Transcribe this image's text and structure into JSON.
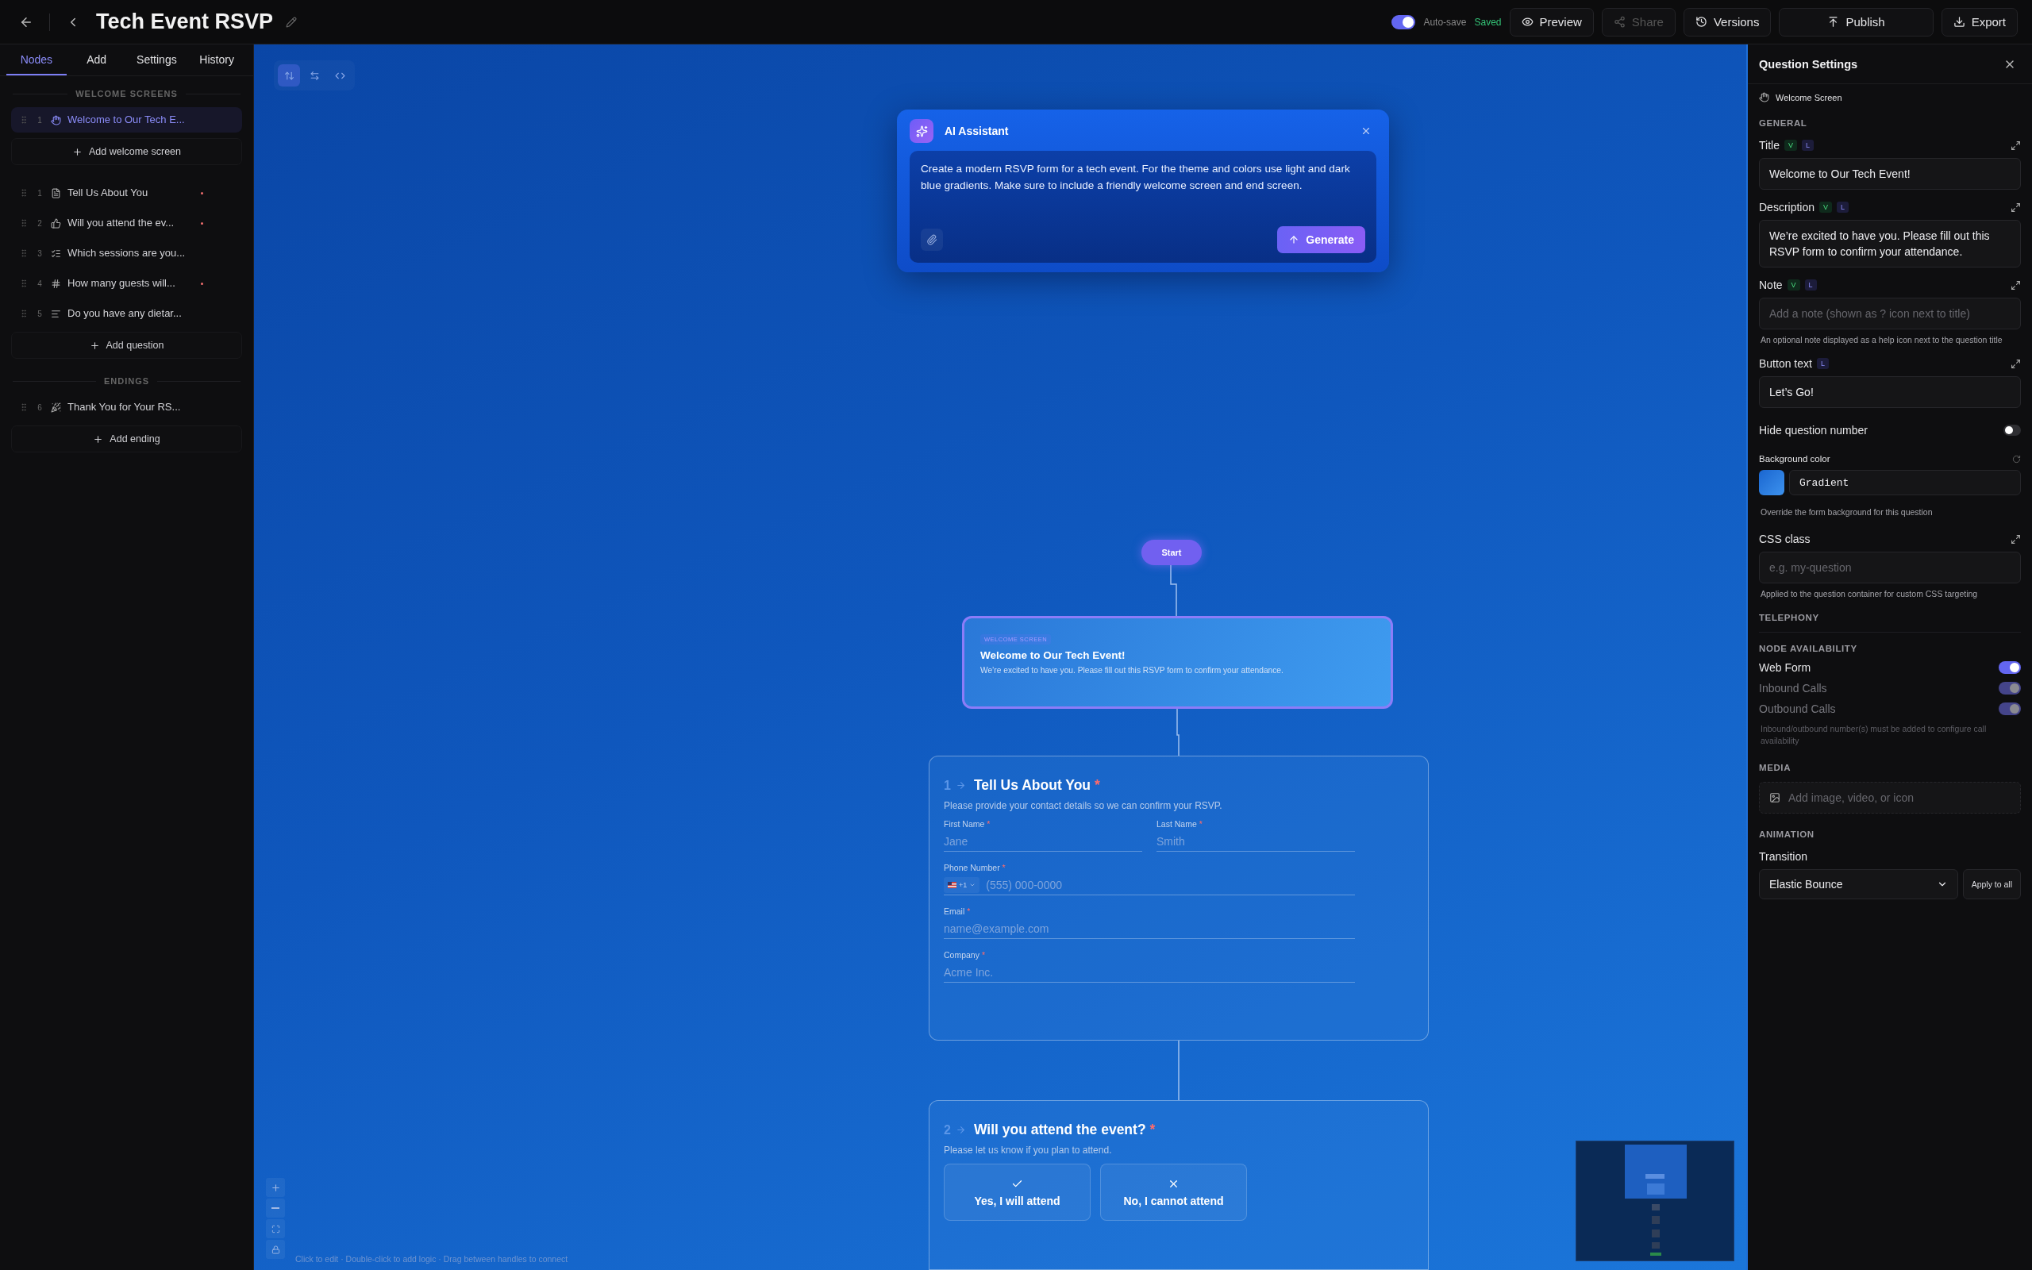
{
  "header": {
    "title": "Tech Event RSVP",
    "autosave": {
      "label": "Auto-save",
      "on": true,
      "status": "Saved"
    },
    "actions": [
      {
        "label": "Preview",
        "kind": "eye",
        "disabled": false
      },
      {
        "label": "Share",
        "kind": "share",
        "disabled": true
      },
      {
        "label": "Versions",
        "kind": "history",
        "disabled": false
      },
      {
        "label": "Publish",
        "kind": "publish",
        "disabled": false
      },
      {
        "label": "Export",
        "kind": "download",
        "disabled": false
      }
    ]
  },
  "sidebar": {
    "tabs": [
      {
        "label": "Nodes",
        "selected": true
      },
      {
        "label": "Add",
        "selected": false
      },
      {
        "label": "Settings",
        "selected": false
      },
      {
        "label": "History",
        "selected": false
      }
    ],
    "sections": [
      {
        "heading": "WELCOME SCREENS",
        "add_label": "Add welcome screen",
        "items": [
          {
            "number": "1",
            "title": "Welcome to Our Tech E...",
            "kind": "welcome",
            "selected": true,
            "required": false
          }
        ]
      },
      {
        "add_label": "Add question",
        "items": [
          {
            "number": "1",
            "title": "Tell Us About You",
            "kind": "contact",
            "selected": false,
            "required": true
          },
          {
            "number": "2",
            "title": "Will you attend the ev...",
            "kind": "yesno",
            "selected": false,
            "required": true
          },
          {
            "number": "3",
            "title": "Which sessions are you...",
            "kind": "checklist",
            "selected": false,
            "required": false
          },
          {
            "number": "4",
            "title": "How many guests will...",
            "kind": "number",
            "selected": false,
            "required": true
          },
          {
            "number": "5",
            "title": "Do you have any dietar...",
            "kind": "text",
            "selected": false,
            "required": false
          }
        ]
      },
      {
        "heading": "ENDINGS",
        "add_label": "Add ending",
        "items": [
          {
            "number": "6",
            "title": "Thank You for Your RS...",
            "kind": "ending",
            "selected": false,
            "required": false
          }
        ]
      }
    ]
  },
  "canvas": {
    "ai_assistant": {
      "title": "AI Assistant",
      "prompt": "Create a modern RSVP form for a tech event. For the theme and colors use light and dark blue gradients. Make sure to include a friendly welcome screen and end screen.",
      "button": "Generate"
    },
    "start_label": "Start",
    "welcome_node": {
      "badge": "WELCOME SCREEN",
      "title": "Welcome to Our Tech Event!",
      "description": "We’re excited to have you. Please fill out this RSVP form to confirm your attendance.",
      "selected": true
    },
    "questions": [
      {
        "number": "1",
        "title": "Tell Us About You",
        "required_mark": "*",
        "description": "Please provide your contact details so we can confirm your RSVP.",
        "fields": [
          {
            "kind": "half",
            "label": "First Name",
            "required_mark": "*",
            "placeholder": "Jane"
          },
          {
            "kind": "half",
            "label": "Last Name",
            "required_mark": "*",
            "placeholder": "Smith"
          },
          {
            "kind": "phone",
            "label": "Phone Number",
            "required_mark": "*",
            "country": "+1",
            "placeholder": "(555) 000-0000"
          },
          {
            "kind": "full",
            "label": "Email",
            "required_mark": "*",
            "placeholder": "name@example.com"
          },
          {
            "kind": "full",
            "label": "Company",
            "required_mark": "*",
            "placeholder": "Acme Inc."
          }
        ]
      },
      {
        "number": "2",
        "title": "Will you attend the event?",
        "required_mark": "*",
        "description": "Please let us know if you plan to attend.",
        "choices": [
          {
            "kind": "check",
            "label": "Yes, I will attend"
          },
          {
            "kind": "cross",
            "label": "No, I cannot attend"
          }
        ]
      }
    ],
    "hint": "Click to edit · Double-click to add logic · Drag between handles to connect"
  },
  "settings": {
    "title": "Question Settings",
    "node_type": "Welcome Screen",
    "general_heading": "GENERAL",
    "fields": [
      {
        "label": "Title",
        "tags": [
          {
            "text": "V",
            "kind": "variable"
          },
          {
            "text": "L",
            "kind": "logic"
          }
        ],
        "value": "Welcome to Our Tech Event!"
      },
      {
        "label": "Description",
        "tags": [
          {
            "text": "V",
            "kind": "variable"
          },
          {
            "text": "L",
            "kind": "logic"
          }
        ],
        "value": "We’re excited to have you. Please fill out this RSVP form to confirm your attendance."
      },
      {
        "label": "Note",
        "tags": [
          {
            "text": "V",
            "kind": "variable"
          },
          {
            "text": "L",
            "kind": "logic"
          }
        ],
        "placeholder": "Add a note (shown as ? icon next to title)",
        "help": "An optional note displayed as a help icon next to the question title"
      },
      {
        "label": "Button text",
        "tags": [
          {
            "text": "L",
            "kind": "logic"
          }
        ],
        "value": "Let’s Go!"
      }
    ],
    "hide_number": {
      "label": "Hide question number",
      "on": false
    },
    "background": {
      "label": "Background color",
      "value": "Gradient",
      "help": "Override the form background for this question"
    },
    "css_class": {
      "label": "CSS class",
      "placeholder": "e.g. my-question",
      "help": "Applied to the question container for custom CSS targeting"
    },
    "telephony_heading": "TELEPHONY",
    "availability": {
      "heading": "NODE AVAILABILITY",
      "items": [
        {
          "label": "Web Form",
          "on": true,
          "disabled": false
        },
        {
          "label": "Inbound Calls",
          "on": true,
          "disabled": true
        },
        {
          "label": "Outbound Calls",
          "on": true,
          "disabled": true
        }
      ],
      "note": "Inbound/outbound number(s) must be added to configure call availability"
    },
    "media": {
      "heading": "MEDIA",
      "placeholder": "Add image, video, or icon"
    },
    "animation": {
      "heading": "ANIMATION",
      "label": "Transition",
      "value": "Elastic Bounce",
      "button": "Apply to all"
    }
  }
}
